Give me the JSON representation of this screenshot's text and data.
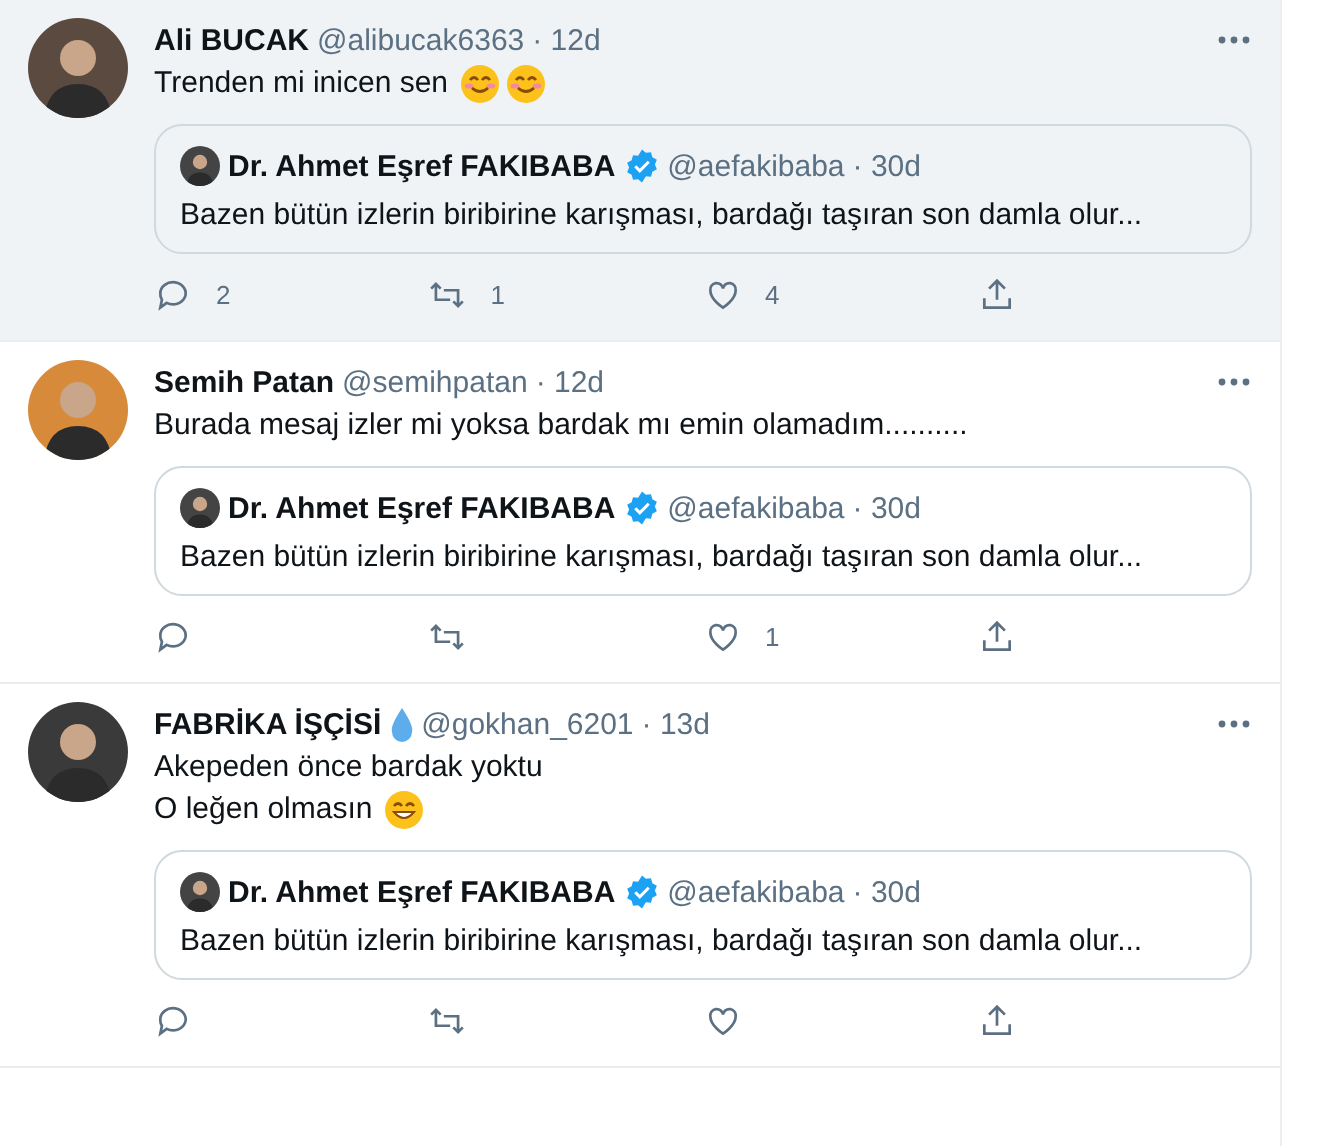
{
  "tweets": [
    {
      "hovered": true,
      "name": "Ali BUCAK",
      "handle": "@alibucak6363",
      "time": "· 12d",
      "lines": [
        {
          "text": "Trenden mi inicen sen",
          "emojis": [
            {
              "kind": "blush"
            },
            {
              "kind": "blush"
            }
          ]
        }
      ],
      "quote": {
        "name": "Dr. Ahmet Eşref FAKIBABA",
        "verified": true,
        "handle": "@aefakibaba",
        "time": "· 30d",
        "text": "Bazen bütün izlerin biribirine karışması, bardağı taşıran son damla olur..."
      },
      "replies": "2",
      "retweets": "1",
      "likes": "4"
    },
    {
      "hovered": false,
      "name": "Semih Patan",
      "handle": "@semihpatan",
      "time": "· 12d",
      "lines": [
        {
          "text": "Burada mesaj izler mi yoksa bardak mı emin olamadım.........."
        }
      ],
      "quote": {
        "name": "Dr. Ahmet Eşref FAKIBABA",
        "verified": true,
        "handle": "@aefakibaba",
        "time": "· 30d",
        "text": "Bazen bütün izlerin biribirine karışması, bardağı taşıran son damla olur..."
      },
      "likes": "1"
    },
    {
      "hovered": false,
      "name": "FABRİKA İŞÇİSİ",
      "name_badge": {
        "kind": "droplet"
      },
      "handle": "@gokhan_6201",
      "time": "· 13d",
      "lines": [
        {
          "text": "Akepeden önce bardak yoktu"
        },
        {
          "text": "O leğen olmasın",
          "emojis": [
            {
              "kind": "grin"
            }
          ]
        }
      ],
      "quote": {
        "name": "Dr. Ahmet Eşref FAKIBABA",
        "verified": true,
        "handle": "@aefakibaba",
        "time": "· 30d",
        "text": "Bazen bütün izlerin biribirine karışması, bardağı taşıran son damla olur..."
      }
    }
  ]
}
